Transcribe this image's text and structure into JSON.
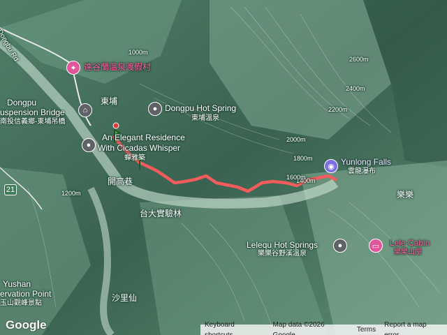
{
  "map": {
    "places": {
      "hotel_ctl": "達谷蘭溫泉渡假村",
      "dongpu": "東埔",
      "bridge_en_1": "Dongpu",
      "bridge_en_2": "uspension Bridge",
      "bridge_zh": "南投信義鄉-東埔吊橋",
      "hot_spring_en": "Dongpu Hot Spring",
      "hot_spring_zh": "東埔溫泉",
      "residence_1": "An Elegant Residence",
      "residence_2": "With Cicadas Whisper",
      "residence_zh": "蟬雅築",
      "kaigao": "開高巷",
      "road": "Dongbu Rd",
      "route_no": "21",
      "forest": "台大實驗林",
      "yunlong_en": "Yunlong Falls",
      "yunlong_zh": "雲龍瀑布",
      "lele": "樂樂",
      "lelequ_en": "Lelequ Hot Springs",
      "lelequ_zh": "樂樂谷野溪溫泉",
      "cabin_en": "Lele Cabin",
      "cabin_zh": "樂樂山屋",
      "shalixian": "沙里仙",
      "yushan_1": "Yushan",
      "yushan_2": "ervation Point",
      "yushan_zh": "玉山觀峰景點"
    },
    "contours": [
      "1400m",
      "1600m",
      "1800m",
      "2000m",
      "2200m",
      "2400m",
      "2600m",
      "1200m",
      "1000m"
    ],
    "icons": {
      "hotel": "hotel-icon",
      "bridge": "bridge-icon",
      "hot_spring": "hot-spring-pin-icon",
      "camera": "camera-icon",
      "bed": "bed-icon"
    },
    "route_color": "#f25c5c"
  },
  "footer": {
    "keyboard": "Keyboard shortcuts",
    "data": "Map data ©2026 Google",
    "terms": "Terms",
    "report": "Report a map error"
  },
  "logo": "Google"
}
